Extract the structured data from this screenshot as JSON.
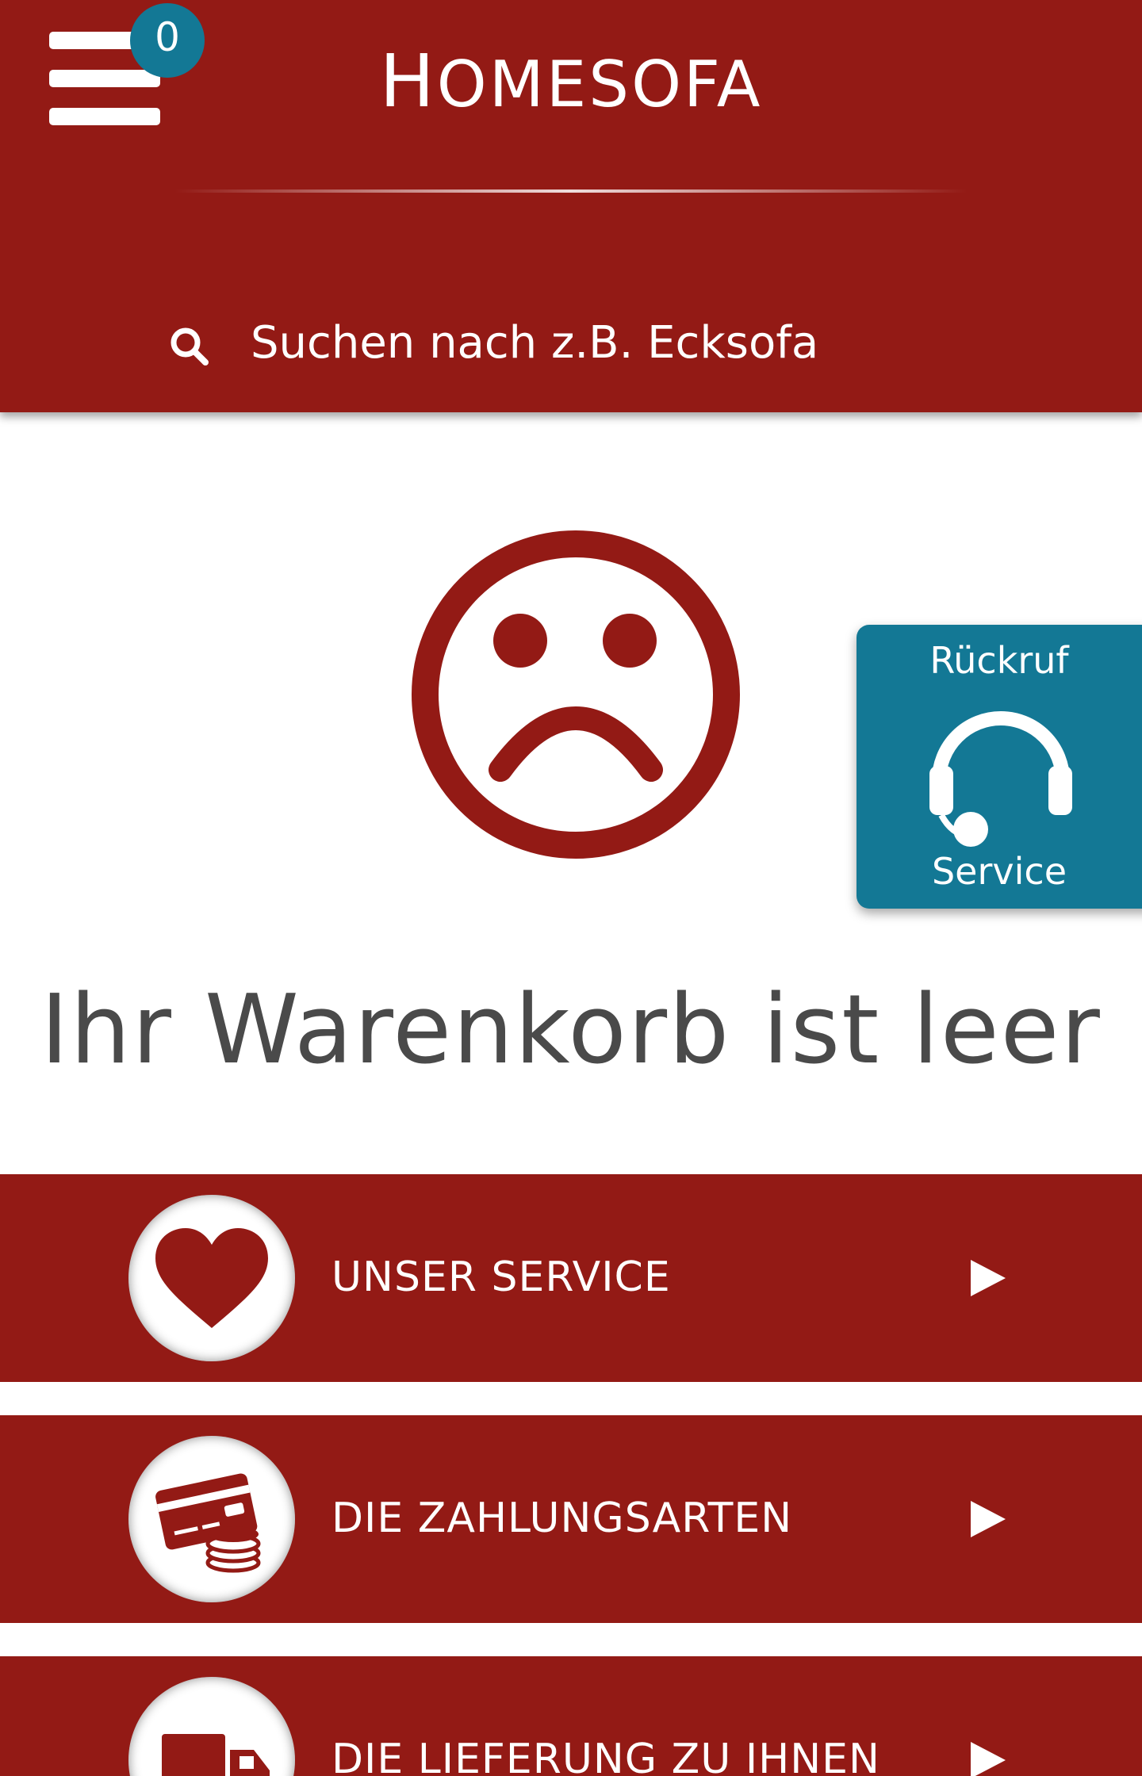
{
  "header": {
    "brand": "Homesofa",
    "cart_count": "0",
    "search": {
      "placeholder": "Suchen nach z.B. Ecksofa"
    }
  },
  "empty_cart": {
    "title": "Ihr Warenkorb ist leer"
  },
  "callback_widget": {
    "top_label": "Rückruf",
    "bottom_label": "Service"
  },
  "info_rows": [
    {
      "label": "UNSER SERVICE",
      "icon": "heart-icon"
    },
    {
      "label": "DIE ZAHLUNGSARTEN",
      "icon": "payment-card-coins-icon"
    },
    {
      "label": "DIE LIEFERUNG ZU IHNEN",
      "icon": "delivery-truck-icon"
    }
  ],
  "colors": {
    "brand_red": "#931a15",
    "accent_teal": "#137895",
    "title_grey": "#4a4a4a"
  }
}
